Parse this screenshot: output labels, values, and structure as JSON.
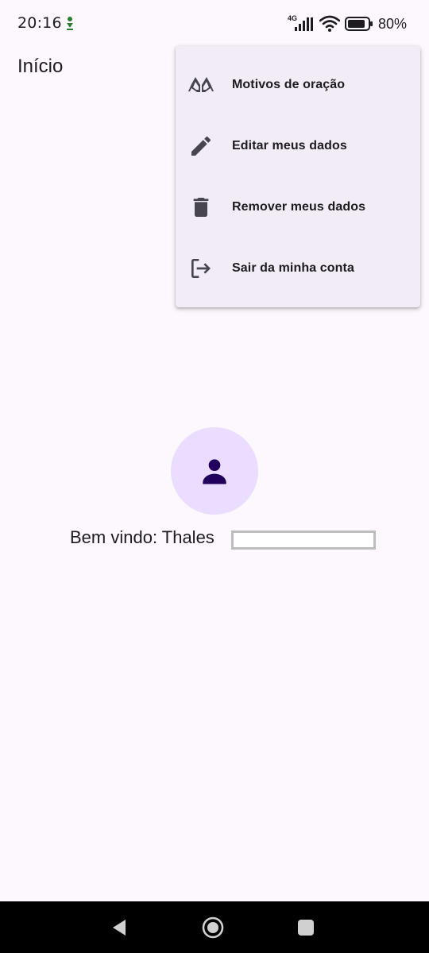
{
  "status_bar": {
    "time": "20:16",
    "network_type": "4G",
    "battery_percent": "80%",
    "icons": [
      "download-notification-icon",
      "signal-icon",
      "wifi-icon",
      "battery-icon"
    ]
  },
  "app_bar": {
    "title": "Início"
  },
  "menu": {
    "items": [
      {
        "label": "Motivos de oração",
        "icon": "praying-hands-icon"
      },
      {
        "label": "Editar meus dados",
        "icon": "pencil-icon"
      },
      {
        "label": "Remover meus dados",
        "icon": "trash-icon"
      },
      {
        "label": "Sair da minha conta",
        "icon": "logout-icon"
      }
    ]
  },
  "profile": {
    "avatar_icon": "person-icon",
    "welcome_text": "Bem vindo: Thales"
  },
  "nav_bar": {
    "buttons": [
      "back-icon",
      "home-icon",
      "recents-icon"
    ]
  },
  "colors": {
    "background": "#FDF7FE",
    "menu_background": "#F2ECF6",
    "avatar_background": "#EADDFF",
    "avatar_icon": "#21005D",
    "icon_color": "#49454F",
    "text_color": "#1D1B20",
    "nav_bar": "#000000"
  }
}
